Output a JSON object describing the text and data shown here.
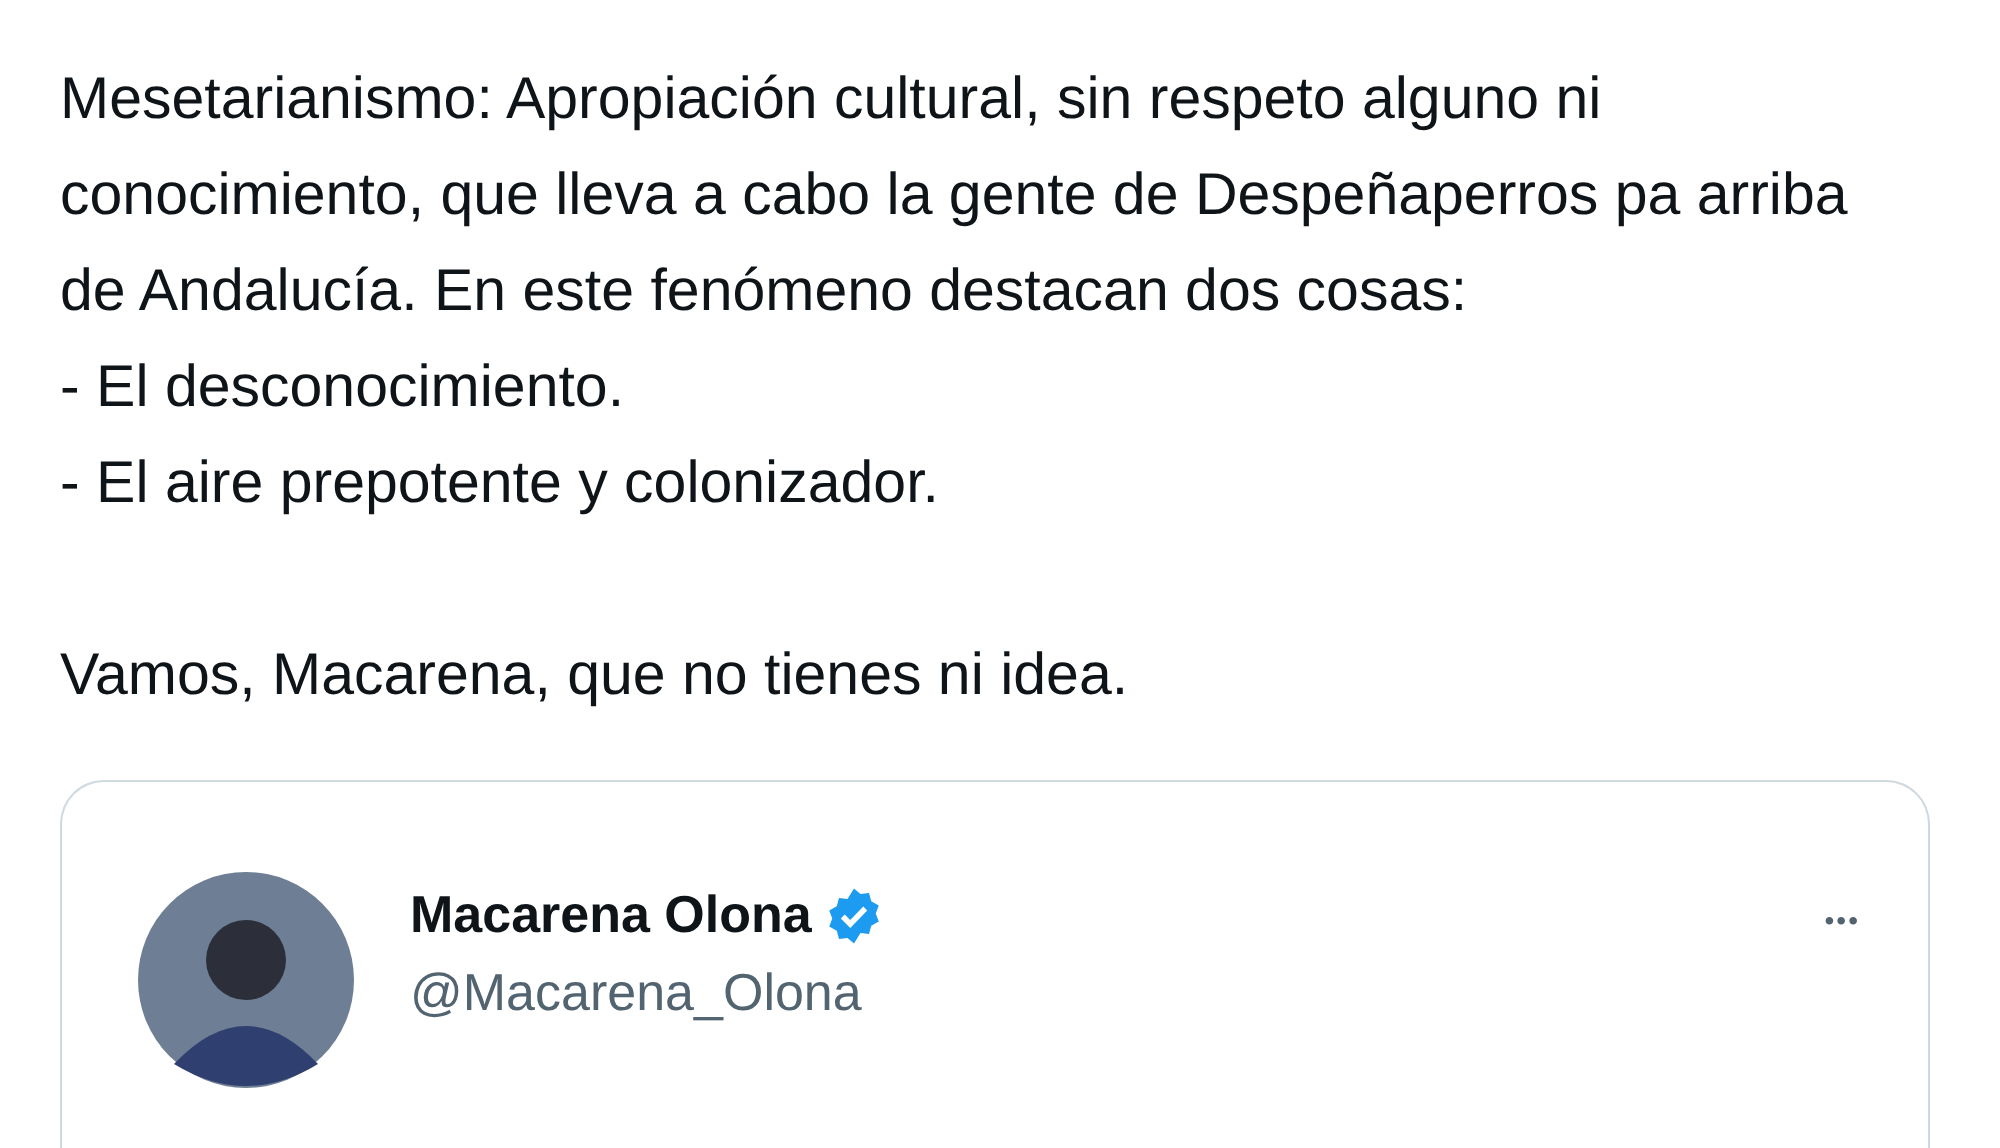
{
  "tweet": {
    "text": "Mesetarianismo: Apropiación cultural, sin respeto alguno ni conocimiento, que lleva a cabo la gente de Despeñaperros pa arriba de Andalucía. En este fenómeno destacan dos cosas:\n- El desconocimiento.\n- El aire prepotente y colonizador.\n\nVamos, Macarena, que no tienes ni idea."
  },
  "quoted_tweet": {
    "author": {
      "name": "Macarena Olona",
      "verified": true,
      "handle": "@Macarena_Olona"
    },
    "more_button": "•••"
  }
}
